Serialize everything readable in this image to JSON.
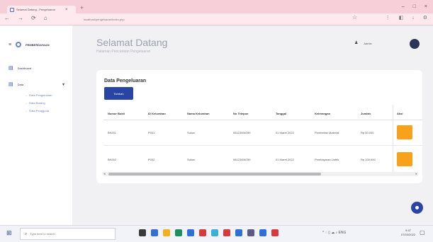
{
  "browser": {
    "tab_title": "Selamat Datang - Pengeluaran",
    "tab_close": "×",
    "new_tab": "+",
    "window_controls": [
      "–",
      "□",
      "×"
    ],
    "nav_icons": [
      "←",
      "→",
      "⟳",
      "⌂"
    ],
    "url": "localhost/pengeluaran/index.php",
    "bookmark_icon": "☆",
    "extension_icons": [
      "⋮",
      "◧",
      "↓",
      "⚙"
    ]
  },
  "sidebar": {
    "menu_icon": "≡",
    "brand": "PEMBERDAYAAN",
    "items": [
      {
        "label": "Dashboard",
        "icon": "▤"
      },
      {
        "label": "Data",
        "icon": "▤",
        "chevron": "▾"
      }
    ],
    "subitems": [
      "Data Pengeluaran",
      "Data Barang",
      "Data Pengguna"
    ]
  },
  "header": {
    "title": "Selamat Datang",
    "subtitle": "Halaman Pencatatan Pengeluaran",
    "user_icon": "♟",
    "user_name": "Admin"
  },
  "card": {
    "title": "Data Pengeluaran",
    "add_button": "Tambah",
    "columns": [
      "Nomor Bukti",
      "ID Kelurahan",
      "Nama Kelurahan",
      "No Telepon",
      "Tanggal",
      "Keterangan",
      "Jumlah",
      "Aksi"
    ],
    "rows": [
      [
        "BK001",
        "P001",
        "Sukun",
        "08123456789",
        "01 Maret 2022",
        "Pembelian Material",
        "Rp 50.000"
      ],
      [
        "BK002",
        "P002",
        "Sukun",
        "08123456789",
        "01 Maret 2022",
        "Pembayaran Listrik",
        "Rp 100.000"
      ]
    ],
    "scroll_left": "◂",
    "scroll_right": "▸"
  },
  "taskbar": {
    "start_icon": "⊞",
    "search_icon": "⌕",
    "search_placeholder": "Type here to search",
    "app_colors": [
      "#3a3a3a",
      "#2f6fd6",
      "#f2b01e",
      "#1d8f5f",
      "#2f6fd6",
      "#d63a3a",
      "#3ab0d6",
      "#d63a3a",
      "#2f6fd6",
      "#5a5a8a",
      "#2f6fd6",
      "#d63a3a"
    ],
    "tray": "^ ◌ ▯ ☁ ♪ ENG",
    "clock_time": "9:47",
    "clock_date": "07/03/2022",
    "notif_icon": "▢"
  }
}
